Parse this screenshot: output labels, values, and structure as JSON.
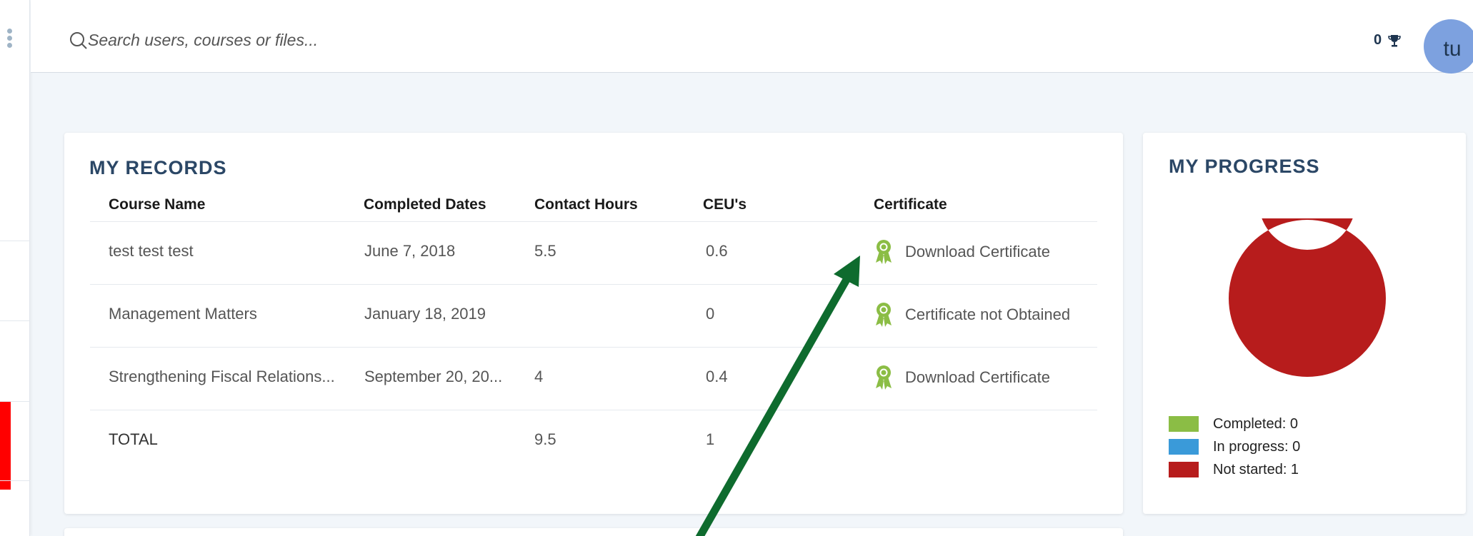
{
  "header": {
    "search_placeholder": "Search users, courses or files...",
    "points": "0",
    "avatar_initials": "tu"
  },
  "records": {
    "title": "MY RECORDS",
    "columns": [
      "Course Name",
      "Completed Dates",
      "Contact Hours",
      "CEU's",
      "Certificate"
    ],
    "rows": [
      {
        "course": "test test test",
        "date": "June 7, 2018",
        "hours": "5.5",
        "ceu": "0.6",
        "certificate": "Download Certificate"
      },
      {
        "course": "Management Matters",
        "date": "January 18, 2019",
        "hours": "",
        "ceu": "0",
        "certificate": "Certificate not Obtained"
      },
      {
        "course": "Strengthening Fiscal Relations...",
        "date": "September 20, 20...",
        "hours": "4",
        "ceu": "0.4",
        "certificate": "Download Certificate"
      }
    ],
    "total": {
      "label": "TOTAL",
      "hours": "9.5",
      "ceu": "1"
    }
  },
  "progress": {
    "title": "MY PROGRESS",
    "legend": [
      {
        "label": "Completed: 0",
        "color": "#8bbd45"
      },
      {
        "label": "In progress: 0",
        "color": "#3a9ad9"
      },
      {
        "label": "Not started: 1",
        "color": "#b71c1c"
      }
    ]
  },
  "chart_data": {
    "type": "pie",
    "categories": [
      "Completed",
      "In progress",
      "Not started"
    ],
    "values": [
      0,
      0,
      1
    ],
    "colors": [
      "#8bbd45",
      "#3a9ad9",
      "#b71c1c"
    ]
  },
  "colors": {
    "accent_link": "#1e8dc4",
    "title": "#2b4766",
    "avatar_bg": "#7da1df",
    "ribbon": "#8bbd45",
    "annotation_arrow": "#0e6b2e"
  }
}
